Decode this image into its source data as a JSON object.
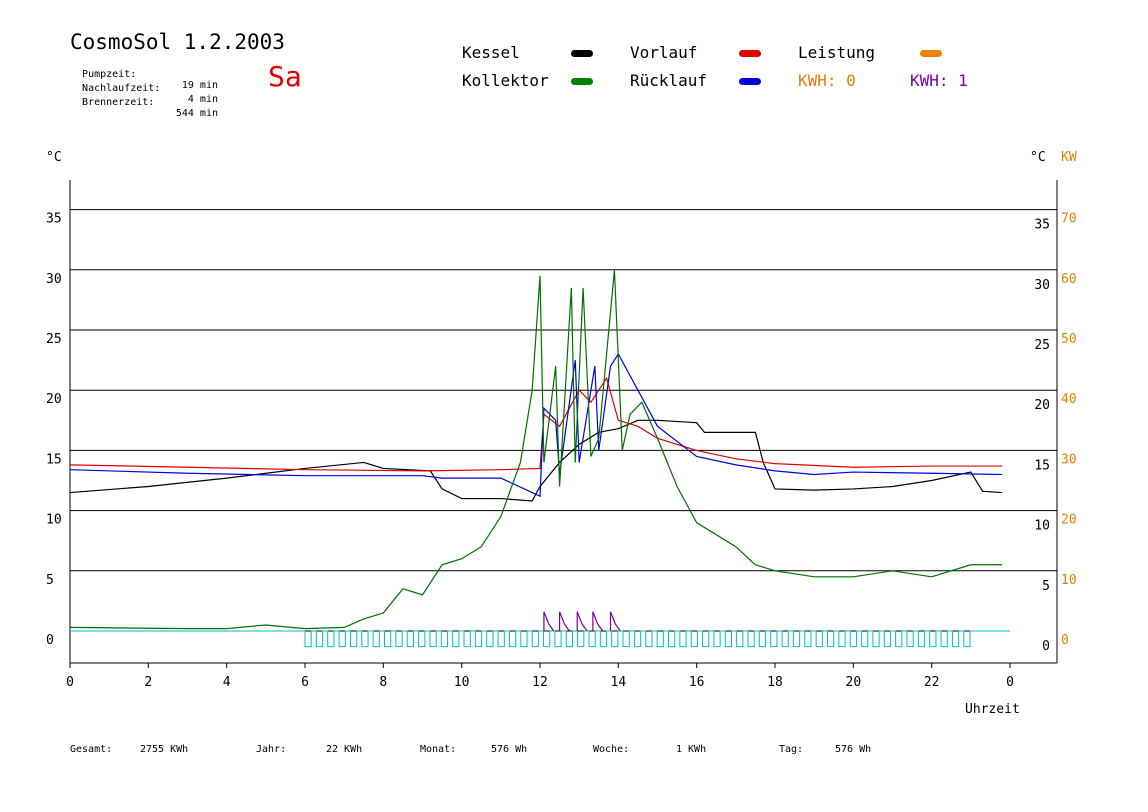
{
  "header": {
    "app_title": "CosmoSol 1.2.2003",
    "day": "Sa",
    "stats": [
      {
        "label": "Pumpzeit:",
        "value": "19 min"
      },
      {
        "label": "Nachlaufzeit:",
        "value": "4 min"
      },
      {
        "label": "Brennerzeit:",
        "value": "544 min"
      }
    ]
  },
  "legend": {
    "kessel": {
      "label": "Kessel",
      "color": "#000000"
    },
    "vorlauf": {
      "label": "Vorlauf",
      "color": "#e00000"
    },
    "leistung": {
      "label": "Leistung",
      "color": "#f08000"
    },
    "kollektor": {
      "label": "Kollektor",
      "color": "#008000"
    },
    "ruecklauf": {
      "label": "Rücklauf",
      "color": "#0000e0"
    },
    "kwh0": {
      "label": "KWH: 0",
      "color": "#e08000"
    },
    "kwh1": {
      "label": "KWH: 1",
      "color": "#8000a0"
    }
  },
  "axes": {
    "left_unit": "°C",
    "right_unit": "°C",
    "right_unit2": "KW",
    "x_label": "Uhrzeit"
  },
  "footer": [
    {
      "label": "Gesamt:",
      "value": "2755 KWh"
    },
    {
      "label": "Jahr:",
      "value": "22 KWh"
    },
    {
      "label": "Monat:",
      "value": "576 Wh"
    },
    {
      "label": "Woche:",
      "value": "1 KWh"
    },
    {
      "label": "Tag:",
      "value": "576 Wh"
    }
  ],
  "chart_data": {
    "type": "line",
    "xlim": [
      0,
      24
    ],
    "ylim": [
      -2,
      40
    ],
    "y2lim": [
      -4,
      80
    ],
    "x_ticks": [
      "0",
      "2",
      "4",
      "6",
      "8",
      "10",
      "12",
      "14",
      "16",
      "18",
      "20",
      "22",
      "0"
    ],
    "y_ticks": [
      0,
      5,
      10,
      15,
      20,
      25,
      30,
      35
    ],
    "y2_ticks": [
      0,
      10,
      20,
      30,
      40,
      50,
      60,
      70
    ],
    "grid": true,
    "series": [
      {
        "name": "Kessel",
        "color": "#000000",
        "x": [
          0,
          2,
          4,
          6,
          7.5,
          8,
          9.2,
          9.5,
          10,
          11,
          11.8,
          12,
          12.5,
          13,
          13.5,
          14,
          14.5,
          15,
          16,
          16.2,
          17.5,
          17.7,
          18,
          19,
          20,
          21,
          22,
          23,
          23.3,
          23.8
        ],
        "y": [
          11.5,
          12.0,
          12.7,
          13.5,
          14.0,
          13.5,
          13.3,
          11.8,
          11.0,
          11.0,
          10.8,
          12.0,
          14.0,
          15.5,
          16.5,
          16.8,
          17.5,
          17.5,
          17.3,
          16.5,
          16.5,
          14.0,
          11.8,
          11.7,
          11.8,
          12.0,
          12.5,
          13.2,
          11.6,
          11.5
        ]
      },
      {
        "name": "Vorlauf",
        "color": "#e00000",
        "x": [
          0,
          3,
          6,
          9,
          11,
          12,
          12.1,
          12.5,
          13,
          13.3,
          13.7,
          14,
          14.5,
          15,
          16,
          17,
          18,
          20,
          22,
          23.8
        ],
        "y": [
          13.8,
          13.6,
          13.4,
          13.3,
          13.4,
          13.5,
          18.0,
          17.0,
          20.0,
          19.0,
          21.0,
          17.5,
          17.0,
          16.0,
          15.0,
          14.3,
          13.9,
          13.6,
          13.7,
          13.7
        ]
      },
      {
        "name": "Rücklauf",
        "color": "#0000e0",
        "x": [
          0,
          3,
          6,
          9,
          9.5,
          11,
          11.8,
          12,
          12.1,
          12.4,
          12.5,
          12.9,
          13,
          13.4,
          13.5,
          13.8,
          14,
          14.5,
          15,
          16,
          17,
          18,
          19,
          20,
          22,
          23.8
        ],
        "y": [
          13.4,
          13.1,
          12.9,
          12.9,
          12.7,
          12.7,
          11.5,
          11.2,
          18.5,
          17.5,
          13.0,
          22.5,
          14.0,
          22.0,
          15.0,
          22.0,
          23.0,
          20.0,
          17.0,
          14.5,
          13.8,
          13.3,
          13.0,
          13.2,
          13.1,
          13.0
        ]
      },
      {
        "name": "Kollektor",
        "color": "#007000",
        "x": [
          0,
          3,
          4,
          5,
          6,
          7,
          7.5,
          8,
          8.5,
          9,
          9.5,
          10,
          10.5,
          11,
          11.5,
          11.8,
          12,
          12.1,
          12.4,
          12.5,
          12.8,
          12.9,
          13.1,
          13.3,
          13.5,
          13.9,
          14.1,
          14.3,
          14.6,
          15,
          15.5,
          16,
          16.5,
          17,
          17.5,
          18,
          19,
          20,
          21,
          22,
          23,
          23.8
        ],
        "y": [
          0.3,
          0.2,
          0.2,
          0.5,
          0.2,
          0.3,
          1.0,
          1.5,
          3.5,
          3.0,
          5.5,
          6.0,
          7.0,
          9.5,
          14.0,
          20.0,
          29.5,
          14.0,
          22.0,
          12.0,
          28.5,
          14.0,
          28.5,
          14.5,
          16.0,
          30.0,
          15.0,
          18.0,
          19.0,
          16.0,
          12.0,
          9.0,
          8.0,
          7.0,
          5.5,
          5.0,
          4.5,
          4.5,
          5.0,
          4.5,
          5.5,
          5.5
        ]
      }
    ],
    "leistung_pulses_x": [
      12.1,
      12.5,
      12.95,
      13.35,
      13.8
    ],
    "leistung_pulse_height": 1.6,
    "pump_pulses": {
      "color": "#00c0c0",
      "start": 6,
      "end": 23.0,
      "period": 0.29,
      "height": -1.3
    }
  }
}
